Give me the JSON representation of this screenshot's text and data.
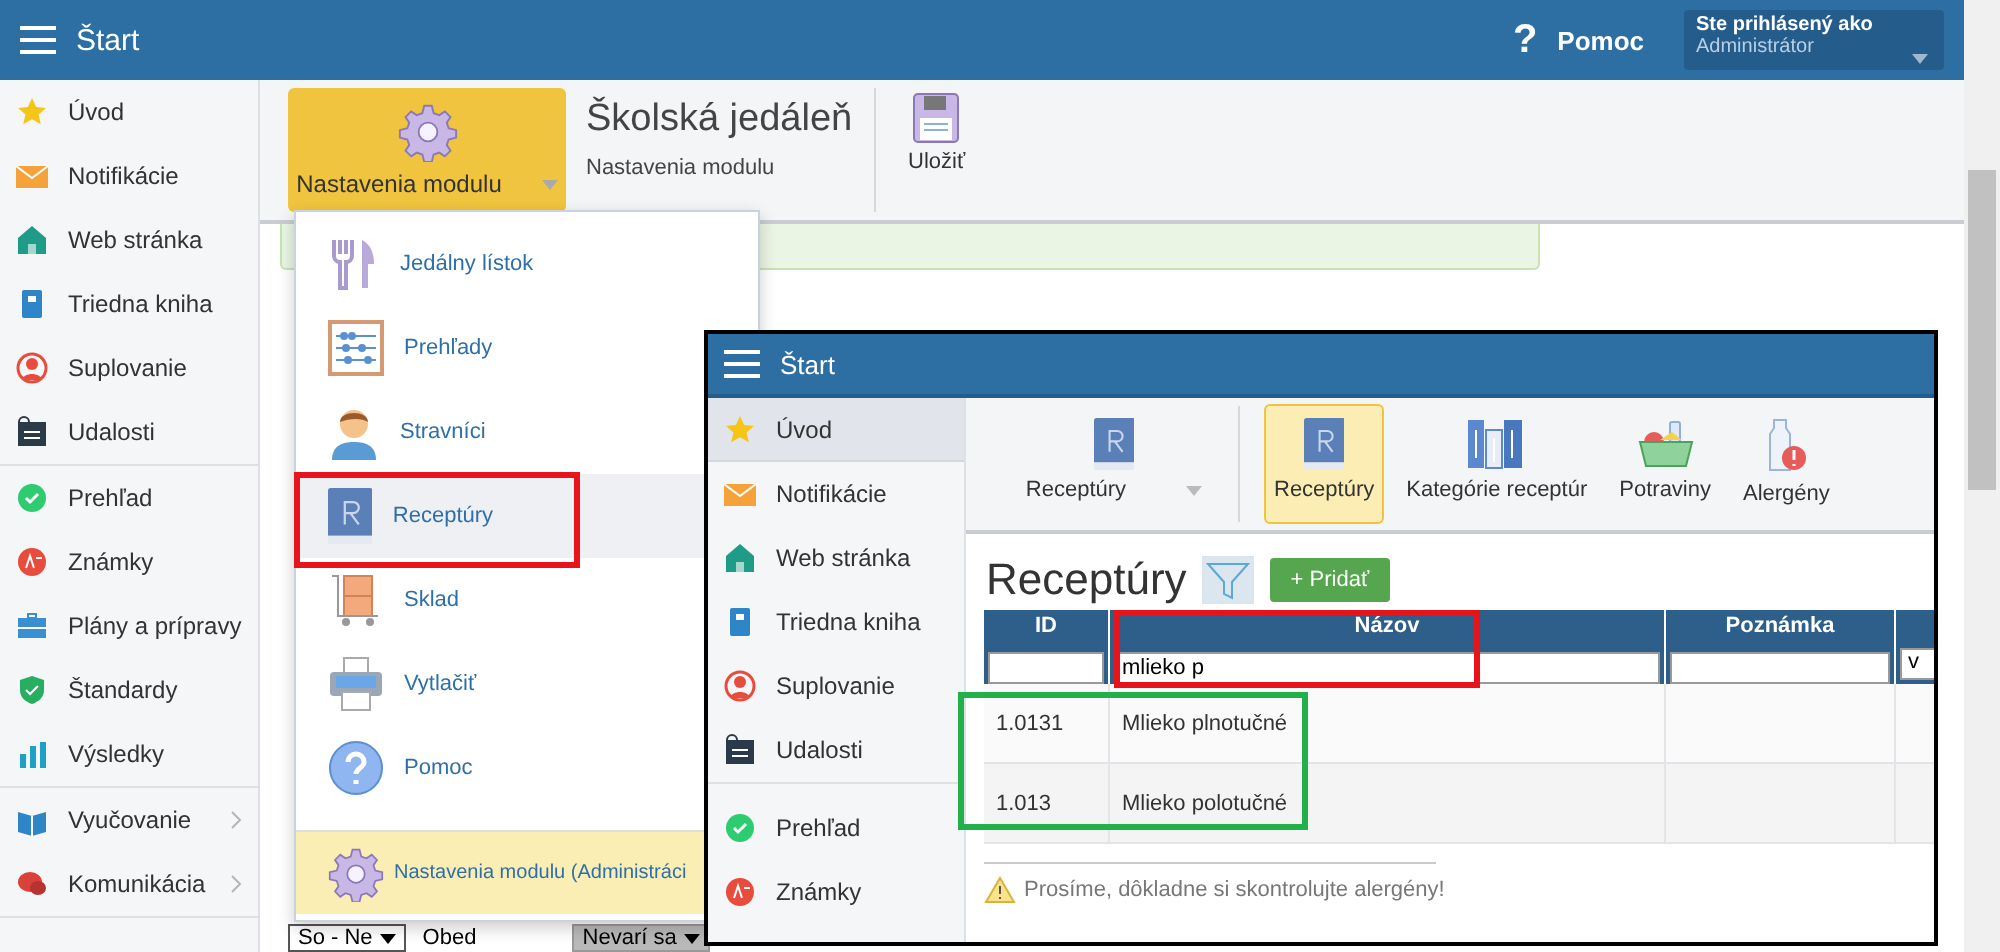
{
  "topbar": {
    "title": "Štart",
    "help_icon": "?",
    "help": "Pomoc",
    "user_label": "Ste prihlásený ako",
    "user_name": "Administrátor"
  },
  "sidebar": {
    "groups": [
      [
        {
          "label": "Úvod"
        },
        {
          "label": "Notifikácie"
        },
        {
          "label": "Web stránka"
        },
        {
          "label": "Triedna kniha"
        },
        {
          "label": "Suplovanie"
        },
        {
          "label": "Udalosti"
        }
      ],
      [
        {
          "label": "Prehľad"
        },
        {
          "label": "Známky"
        },
        {
          "label": "Plány a prípravy"
        },
        {
          "label": "Štandardy"
        },
        {
          "label": "Výsledky"
        }
      ],
      [
        {
          "label": "Vyučovanie",
          "has_submenu": true
        },
        {
          "label": "Komunikácia",
          "has_submenu": true
        }
      ]
    ]
  },
  "toolbar": {
    "module_button": {
      "label": "Nastavenia modulu",
      "selected": true
    },
    "title": "Školská jedáleň",
    "subtitle": "Nastavenia modulu",
    "save": "Uložiť"
  },
  "module_menu": {
    "items": [
      {
        "label": "Jedálny lístok",
        "kind": "item",
        "selected": false
      },
      {
        "label": "Prehľady",
        "kind": "item",
        "selected": false
      },
      {
        "label": "Stravníci",
        "kind": "item",
        "selected": false
      },
      {
        "label": "Receptúry",
        "kind": "item",
        "selected": true
      },
      {
        "label": "Sklad",
        "kind": "item",
        "selected": false
      },
      {
        "label": "Vytlačiť",
        "kind": "item",
        "selected": false
      },
      {
        "label": "Pomoc",
        "kind": "item",
        "selected": false
      },
      {
        "label": "Nastavenia modulu (Administráci",
        "kind": "admin",
        "selected": false
      }
    ]
  },
  "filter_row": [
    {
      "kind": "select",
      "value": "So - Ne"
    },
    {
      "kind": "text",
      "value": "Obed"
    },
    {
      "kind": "select_grey",
      "value": "Nevarí sa"
    }
  ],
  "inset": {
    "topbar": {
      "title": "Štart"
    },
    "sidebar": [
      {
        "label": "Úvod",
        "selected": true
      },
      {
        "label": "Notifikácie",
        "selected": false
      },
      {
        "label": "Web stránka",
        "selected": false
      },
      {
        "label": "Triedna kniha",
        "selected": false
      },
      {
        "label": "Suplovanie",
        "selected": false
      },
      {
        "label": "Udalosti",
        "selected": false
      },
      {
        "label": "Prehľad",
        "selected": false
      },
      {
        "label": "Známky",
        "selected": false
      }
    ],
    "toolbar": [
      {
        "label": "Receptúry",
        "kind": "dropdown",
        "selected": false
      },
      {
        "label": "Receptúry",
        "kind": "tool",
        "selected": true
      },
      {
        "label": "Kategórie receptúr",
        "kind": "tool",
        "selected": false
      },
      {
        "label": "Potraviny",
        "kind": "tool",
        "selected": false
      },
      {
        "label": "Alergény",
        "kind": "tool",
        "selected": false
      }
    ],
    "heading": "Receptúry",
    "add_button": "+ Pridať",
    "table": {
      "columns": [
        {
          "label": "ID",
          "filter": {
            "kind": "text"
          }
        },
        {
          "label": "Názov",
          "filter": {
            "kind": "text",
            "value": "mlieko p"
          }
        },
        {
          "label": "Poznámka",
          "filter": {
            "kind": "text"
          }
        },
        {
          "filter": {
            "kind": "select",
            "value": "v"
          }
        }
      ],
      "rows": [
        {
          "id": "1.0131",
          "name": "Mlieko plnotučné"
        },
        {
          "id": "1.013",
          "name": "Mlieko polotučné"
        }
      ]
    },
    "warning": "Prosíme, dôkladne si skontrolujte alergény!"
  },
  "annotations": [
    {
      "color": "#e8141c"
    },
    {
      "color": "#e8141c"
    },
    {
      "color": "#22b04b"
    }
  ]
}
